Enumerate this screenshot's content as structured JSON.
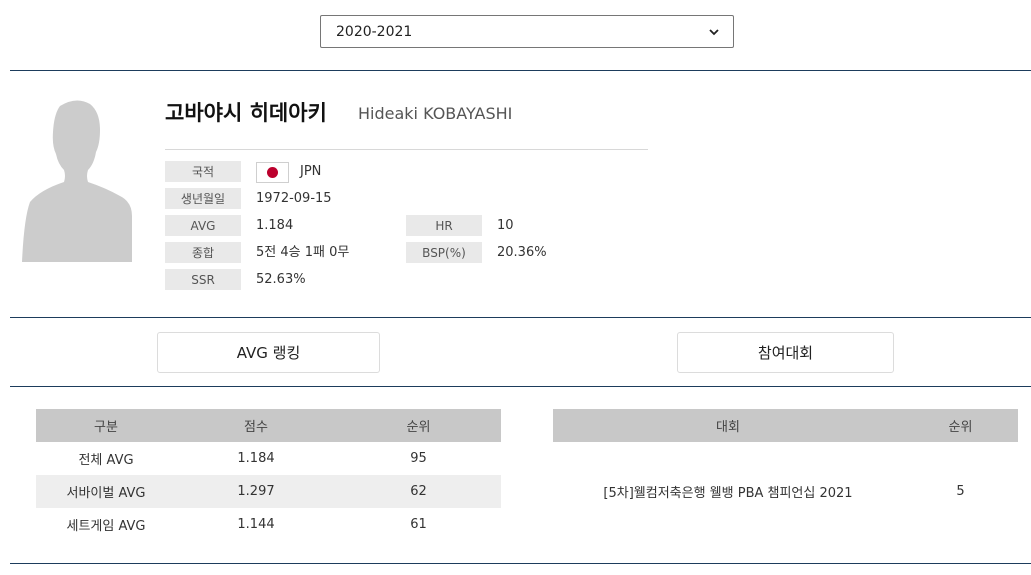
{
  "season_select": {
    "value": "2020-2021"
  },
  "player": {
    "name_kor": "고바야시 히데아키",
    "name_eng": "Hideaki KOBAYASHI",
    "flag_colors": {
      "field": "#ffffff",
      "circle": "#bc002d"
    },
    "fields": {
      "nationality_label": "국적",
      "nationality_value": "JPN",
      "birth_label": "생년월일",
      "birth_value": "1972-09-15",
      "avg_label": "AVG",
      "avg_value": "1.184",
      "hr_label": "HR",
      "hr_value": "10",
      "record_label": "종합",
      "record_value": "5전 4승 1패 0무",
      "bsp_label": "BSP(%)",
      "bsp_value": "20.36%",
      "ssr_label": "SSR",
      "ssr_value": "52.63%"
    }
  },
  "tabs": {
    "avg_ranking": "AVG 랭킹",
    "tournaments": "참여대회"
  },
  "avg_table": {
    "headers": [
      "구분",
      "점수",
      "순위"
    ],
    "rows": [
      [
        "전체 AVG",
        "1.184",
        "95"
      ],
      [
        "서바이벌 AVG",
        "1.297",
        "62"
      ],
      [
        "세트게임 AVG",
        "1.144",
        "61"
      ]
    ]
  },
  "tournament_table": {
    "headers": [
      "대회",
      "순위"
    ],
    "rows": [
      [
        "[5차]웰컴저축은행 웰뱅 PBA 챔피언십 2021",
        "5"
      ]
    ]
  },
  "colors": {
    "divider": "#1d3c5c",
    "label_bg": "#e9e9e9",
    "table_header_bg": "#c8c8c8",
    "alt_row_bg": "#eeeeee"
  }
}
